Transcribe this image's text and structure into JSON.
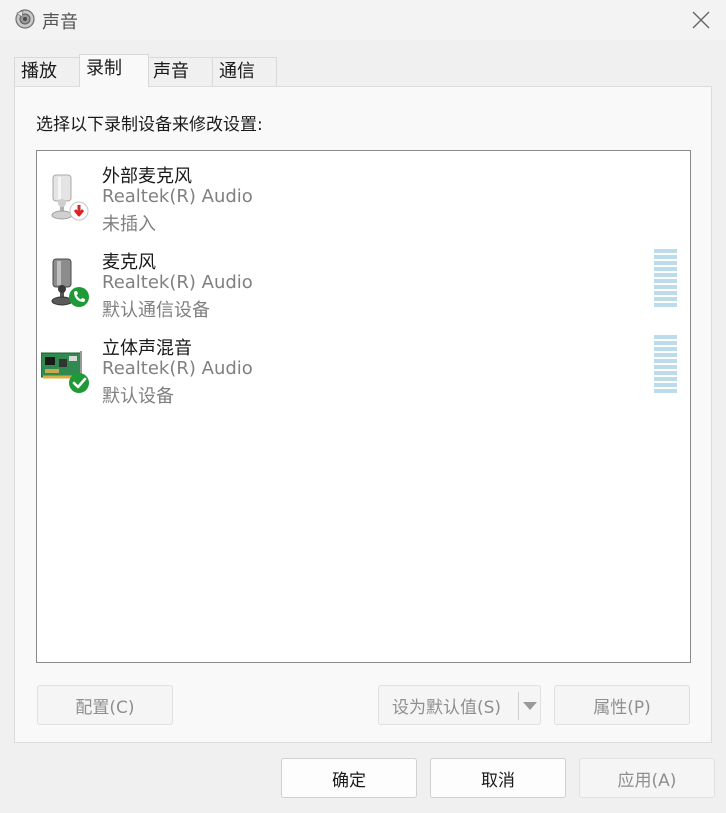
{
  "window": {
    "title": "声音"
  },
  "tabs": [
    {
      "label": "播放"
    },
    {
      "label": "录制",
      "active": true
    },
    {
      "label": "声音"
    },
    {
      "label": "通信"
    }
  ],
  "instruction": "选择以下录制设备来修改设置:",
  "devices": [
    {
      "name": "外部麦克风",
      "driver": "Realtek(R) Audio",
      "status": "未插入",
      "icon": "external-microphone-icon",
      "badge": "unplugged-arrow-badge"
    },
    {
      "name": "麦克风",
      "driver": "Realtek(R) Audio",
      "status": "默认通信设备",
      "icon": "microphone-icon",
      "badge": "phone-badge"
    },
    {
      "name": "立体声混音",
      "driver": "Realtek(R) Audio",
      "status": "默认设备",
      "icon": "sound-card-icon",
      "badge": "check-badge"
    }
  ],
  "buttons": {
    "configure": "配置(C)",
    "set_default": "设为默认值(S)",
    "properties": "属性(P)",
    "ok": "确定",
    "cancel": "取消",
    "apply": "应用(A)"
  },
  "colors": {
    "meter": "#bcdceb",
    "badge_green": "#1e9a36",
    "badge_red": "#d6262a"
  }
}
